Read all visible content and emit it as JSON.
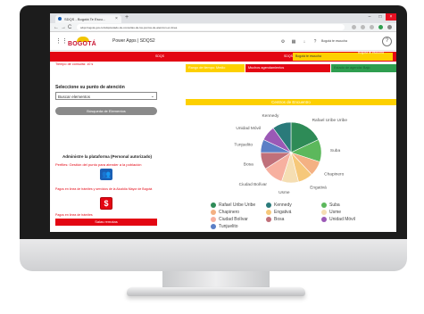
{
  "browser": {
    "tab_title": "SDQS - Bogotá Te Escu...",
    "tab_close": "×",
    "new_tab": "+",
    "url": "sdqs.bogota.gov.co/sdqs/estado-de-consultas-de-los-puntos-de-atencion-en-linea",
    "nav_back": "←",
    "nav_forward": "→",
    "nav_reload": "C",
    "win_min": "–",
    "win_max": "□",
    "win_close": "×"
  },
  "header": {
    "logo_text": "BOGOTÁ",
    "app_title": "Power Apps | SDQS2",
    "user_label": "Bogotá te escucha",
    "avatar_glyph": "?"
  },
  "redbar": {
    "center_text": "SDQS",
    "tag_text": "SDQS",
    "yellow_text": "Bogotá te escucha",
    "link_text": "Bogotá te escucha"
  },
  "left": {
    "note": "Tiempo de consulta: 10 s",
    "section_title": "Seleccione su punto de atención",
    "select_value": "Buscar elementos",
    "select_caret": "⌄",
    "search_button": "Búsqueda de Elementos",
    "admin_title": "Administre la plataforma (Personal autorizado)",
    "admin_link": "Perfiles: Gestión del punto para atender a la población",
    "admin_icon": "👥",
    "pay_text": "Pagos en línea de trámites y servicios de la Alcaldía Mayor de Bogotá",
    "pay_icon": "$",
    "pay_link": "Pagos en línea de trámites",
    "red_button": "Salas remotas"
  },
  "status": {
    "yellow": "Rango de tiempo: Medio",
    "red": "Muchos agendamientos",
    "green": "Estado de agenda: Bajo"
  },
  "chart_data": {
    "type": "pie",
    "title": "Centros de Encuentro",
    "slices": [
      {
        "label": "Rafael Uribe Uribe",
        "value": 18,
        "color": "#2e8b57"
      },
      {
        "label": "Suba",
        "value": 12,
        "color": "#5cb85c"
      },
      {
        "label": "Chapinero",
        "value": 8,
        "color": "#f4b183"
      },
      {
        "label": "Engativá",
        "value": 8,
        "color": "#f6c87a"
      },
      {
        "label": "Usme",
        "value": 9,
        "color": "#f5deb3"
      },
      {
        "label": "Ciudad Bolívar",
        "value": 11,
        "color": "#f7b0a0"
      },
      {
        "label": "Bosa",
        "value": 9,
        "color": "#c0707a"
      },
      {
        "label": "Tunjuelito",
        "value": 7,
        "color": "#5b7fc6"
      },
      {
        "label": "Unidad Móvil",
        "value": 8,
        "color": "#9b59b6"
      },
      {
        "label": "Kennedy",
        "value": 10,
        "color": "#2a7a7a"
      }
    ],
    "callouts": [
      "Kennedy",
      "Unidad Móvil",
      "Rafael Uribe Ur...",
      "Bosa",
      "Suba",
      "Ciudad Bolívar",
      "Usme",
      "Chapinero",
      "Engativá"
    ]
  },
  "legend": [
    {
      "label": "Rafael Uribe Uribe",
      "color": "#2e8b57"
    },
    {
      "label": "Kennedy",
      "color": "#2a7a7a"
    },
    {
      "label": "Suba",
      "color": "#5cb85c"
    },
    {
      "label": "Chapinero",
      "color": "#f4b183"
    },
    {
      "label": "Engativá",
      "color": "#f6c87a"
    },
    {
      "label": "Usme",
      "color": "#f5deb3"
    },
    {
      "label": "Ciudad Bolívar",
      "color": "#f7b0a0"
    },
    {
      "label": "Bosa",
      "color": "#c0707a"
    },
    {
      "label": "Unidad Móvil",
      "color": "#9b59b6"
    },
    {
      "label": "Tunjuelito",
      "color": "#5b7fc6"
    }
  ]
}
